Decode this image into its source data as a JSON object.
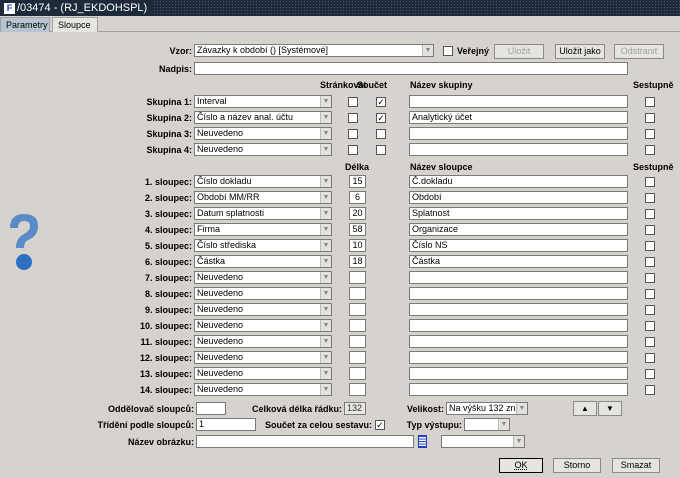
{
  "title": "/03474 - (RJ_EKDOHSPL)",
  "tabs": [
    {
      "label": "Parametry",
      "active": false
    },
    {
      "label": "Sloupce",
      "active": true
    }
  ],
  "vzor": {
    "label": "Vzor:",
    "value": "Závazky k období  ()  [Systémové]",
    "public_label": "Veřejný",
    "public_checked": false,
    "save": "Uložit",
    "save_as": "Uložit jako",
    "remove": "Odstranit"
  },
  "nadpis": {
    "label": "Nadpis:",
    "value": ""
  },
  "group_headers": {
    "paging": "Stránkovat",
    "sum": "Součet",
    "name": "Název skupiny",
    "desc": "Sestupně"
  },
  "groups": [
    {
      "label": "Skupina 1:",
      "value": "Interval",
      "paging": false,
      "sum": true,
      "name": "",
      "desc": false
    },
    {
      "label": "Skupina 2:",
      "value": "Číslo a název anal. účtu",
      "paging": false,
      "sum": true,
      "name": "Analytický účet",
      "desc": false
    },
    {
      "label": "Skupina 3:",
      "value": "Neuvedeno",
      "paging": false,
      "sum": false,
      "name": "",
      "desc": false
    },
    {
      "label": "Skupina 4:",
      "value": "Neuvedeno",
      "paging": false,
      "sum": false,
      "name": "",
      "desc": false
    }
  ],
  "column_headers": {
    "length": "Délka",
    "name": "Název sloupce",
    "desc": "Sestupně"
  },
  "columns": [
    {
      "label": "1. sloupec:",
      "value": "Číslo dokladu",
      "length": "15",
      "name": "Č.dokladu"
    },
    {
      "label": "2. sloupec:",
      "value": "Období MM/RR",
      "length": "6",
      "name": "Období"
    },
    {
      "label": "3. sloupec:",
      "value": "Datum splatnosti",
      "length": "20",
      "name": "Splatnost"
    },
    {
      "label": "4. sloupec:",
      "value": "Firma",
      "length": "58",
      "name": "Organizace"
    },
    {
      "label": "5. sloupec:",
      "value": "Číslo střediska",
      "length": "10",
      "name": "Číslo NS"
    },
    {
      "label": "6. sloupec:",
      "value": "Částka",
      "length": "18",
      "name": "Částka"
    },
    {
      "label": "7. sloupec:",
      "value": "Neuvedeno",
      "length": "",
      "name": ""
    },
    {
      "label": "8. sloupec:",
      "value": "Neuvedeno",
      "length": "",
      "name": ""
    },
    {
      "label": "9. sloupec:",
      "value": "Neuvedeno",
      "length": "",
      "name": ""
    },
    {
      "label": "10. sloupec:",
      "value": "Neuvedeno",
      "length": "",
      "name": ""
    },
    {
      "label": "11. sloupec:",
      "value": "Neuvedeno",
      "length": "",
      "name": ""
    },
    {
      "label": "12. sloupec:",
      "value": "Neuvedeno",
      "length": "",
      "name": ""
    },
    {
      "label": "13. sloupec:",
      "value": "Neuvedeno",
      "length": "",
      "name": ""
    },
    {
      "label": "14. sloupec:",
      "value": "Neuvedeno",
      "length": "",
      "name": ""
    }
  ],
  "bottom": {
    "separator_label": "Oddělovač sloupců:",
    "separator": "",
    "total_label": "Celková délka řádku:",
    "total": "132",
    "size_label": "Velikost:",
    "size": "Na výšku 132 zn.",
    "sort_label": "Třídění podle sloupců:",
    "sort": "1",
    "grand_total_label": "Součet za celou sestavu:",
    "grand_total": true,
    "output_label": "Typ výstupu:",
    "output": "",
    "image_label": "Název obrázku:",
    "image": "",
    "image_type": ""
  },
  "buttons": {
    "ok": "OK",
    "cancel": "Storno",
    "delete": "Smazat"
  }
}
